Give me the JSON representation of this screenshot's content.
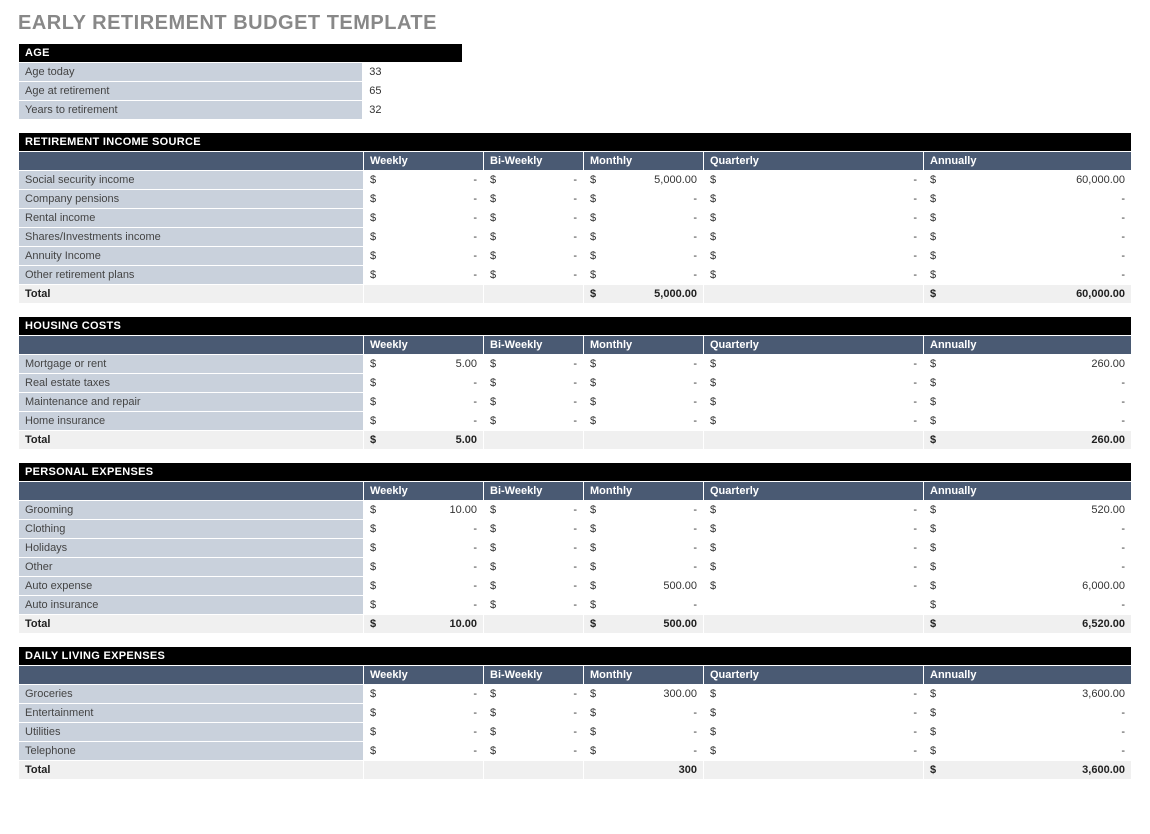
{
  "title": "EARLY RETIREMENT BUDGET TEMPLATE",
  "currency_symbol": "$",
  "dash": "-",
  "columns": [
    "Weekly",
    "Bi-Weekly",
    "Monthly",
    "Quarterly",
    "Annually"
  ],
  "age": {
    "header": "AGE",
    "rows": [
      {
        "label": "Age today",
        "value": "33"
      },
      {
        "label": "Age at retirement",
        "value": "65"
      },
      {
        "label": "Years to retirement",
        "value": "32"
      }
    ]
  },
  "sections": [
    {
      "header": "RETIREMENT INCOME SOURCE",
      "rows": [
        {
          "label": "Social security income",
          "weekly": "-",
          "biweekly": "-",
          "monthly": "5,000.00",
          "quarterly": "-",
          "annually": "60,000.00"
        },
        {
          "label": "Company pensions",
          "weekly": "-",
          "biweekly": "-",
          "monthly": "-",
          "quarterly": "-",
          "annually": "-"
        },
        {
          "label": "Rental income",
          "weekly": "-",
          "biweekly": "-",
          "monthly": "-",
          "quarterly": "-",
          "annually": "-"
        },
        {
          "label": "Shares/Investments income",
          "weekly": "-",
          "biweekly": "-",
          "monthly": "-",
          "quarterly": "-",
          "annually": "-"
        },
        {
          "label": "Annuity Income",
          "weekly": "-",
          "biweekly": "-",
          "monthly": "-",
          "quarterly": "-",
          "annually": "-"
        },
        {
          "label": "Other retirement plans",
          "weekly": "-",
          "biweekly": "-",
          "monthly": "-",
          "quarterly": "-",
          "annually": "-"
        }
      ],
      "total": {
        "label": "Total",
        "weekly": "",
        "biweekly": "",
        "monthly": "5,000.00",
        "quarterly": "",
        "annually": "60,000.00",
        "sym_weekly": "",
        "sym_biweekly": "",
        "sym_monthly": "$",
        "sym_quarterly": "",
        "sym_annually": "$"
      }
    },
    {
      "header": "HOUSING COSTS",
      "rows": [
        {
          "label": "Mortgage or rent",
          "weekly": "5.00",
          "biweekly": "-",
          "monthly": "-",
          "quarterly": "-",
          "annually": "260.00"
        },
        {
          "label": "Real estate taxes",
          "weekly": "-",
          "biweekly": "-",
          "monthly": "-",
          "quarterly": "-",
          "annually": "-"
        },
        {
          "label": "Maintenance and repair",
          "weekly": "-",
          "biweekly": "-",
          "monthly": "-",
          "quarterly": "-",
          "annually": "-"
        },
        {
          "label": "Home insurance",
          "weekly": "-",
          "biweekly": "-",
          "monthly": "-",
          "quarterly": "-",
          "annually": "-"
        }
      ],
      "total": {
        "label": "Total",
        "weekly": "5.00",
        "biweekly": "",
        "monthly": "",
        "quarterly": "",
        "annually": "260.00",
        "sym_weekly": "$",
        "sym_biweekly": "",
        "sym_monthly": "",
        "sym_quarterly": "",
        "sym_annually": "$"
      }
    },
    {
      "header": "PERSONAL EXPENSES",
      "rows": [
        {
          "label": "Grooming",
          "weekly": "10.00",
          "biweekly": "-",
          "monthly": "-",
          "quarterly": "-",
          "annually": "520.00"
        },
        {
          "label": "Clothing",
          "weekly": "-",
          "biweekly": "-",
          "monthly": "-",
          "quarterly": "-",
          "annually": "-"
        },
        {
          "label": "Holidays",
          "weekly": "-",
          "biweekly": "-",
          "monthly": "-",
          "quarterly": "-",
          "annually": "-"
        },
        {
          "label": "Other",
          "weekly": "-",
          "biweekly": "-",
          "monthly": "-",
          "quarterly": "-",
          "annually": "-"
        },
        {
          "label": "Auto expense",
          "weekly": "-",
          "biweekly": "-",
          "monthly": "500.00",
          "quarterly": "-",
          "annually": "6,000.00"
        },
        {
          "label": "Auto insurance",
          "weekly": "-",
          "biweekly": "-",
          "monthly": "-",
          "quarterly": "",
          "annually": "-"
        }
      ],
      "total": {
        "label": "Total",
        "weekly": "10.00",
        "biweekly": "",
        "monthly": "500.00",
        "quarterly": "",
        "annually": "6,520.00",
        "sym_weekly": "$",
        "sym_biweekly": "",
        "sym_monthly": "$",
        "sym_quarterly": "",
        "sym_annually": "$"
      }
    },
    {
      "header": "DAILY LIVING EXPENSES",
      "rows": [
        {
          "label": "Groceries",
          "weekly": "-",
          "biweekly": "-",
          "monthly": "300.00",
          "quarterly": "-",
          "annually": "3,600.00"
        },
        {
          "label": "Entertainment",
          "weekly": "-",
          "biweekly": "-",
          "monthly": "-",
          "quarterly": "-",
          "annually": "-"
        },
        {
          "label": "Utilities",
          "weekly": "-",
          "biweekly": "-",
          "monthly": "-",
          "quarterly": "-",
          "annually": "-"
        },
        {
          "label": "Telephone",
          "weekly": "-",
          "biweekly": "-",
          "monthly": "-",
          "quarterly": "-",
          "annually": "-"
        }
      ],
      "total": {
        "label": "Total",
        "weekly": "",
        "biweekly": "",
        "monthly": "300",
        "quarterly": "",
        "annually": "3,600.00",
        "sym_weekly": "",
        "sym_biweekly": "",
        "sym_monthly": "",
        "sym_quarterly": "",
        "sym_annually": "$"
      }
    }
  ]
}
